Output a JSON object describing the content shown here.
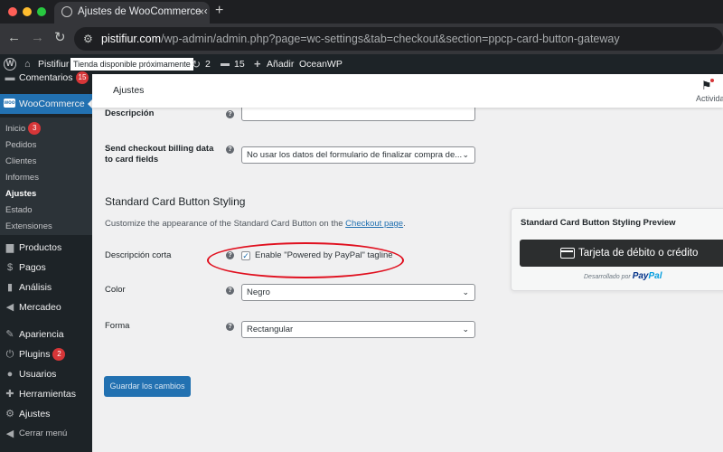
{
  "browser": {
    "tab_title": "Ajustes de WooCommerce ‹",
    "tab_close": "×",
    "new_tab": "+",
    "url_host": "pistifiur.com",
    "url_path": "/wp-admin/admin.php?page=wc-settings&tab=checkout&section=ppcp-card-button-gateway"
  },
  "adminbar": {
    "site_name": "Pistifiur",
    "site_badge": "Tienda disponible próximamente",
    "updates_count": "2",
    "comments_count": "15",
    "new_label": "Añadir",
    "theme_label": "OceanWP"
  },
  "sidebar": {
    "comments": {
      "label": "Comentarios",
      "count": "15"
    },
    "woocommerce": "WooCommerce",
    "submenu": [
      {
        "label": "Inicio",
        "count": "3"
      },
      {
        "label": "Pedidos"
      },
      {
        "label": "Clientes"
      },
      {
        "label": "Informes"
      },
      {
        "label": "Ajustes"
      },
      {
        "label": "Estado"
      },
      {
        "label": "Extensiones"
      }
    ],
    "items": [
      {
        "label": "Productos",
        "icon": "archive-icon"
      },
      {
        "label": "Pagos",
        "icon": "dollar-icon"
      },
      {
        "label": "Análisis",
        "icon": "bar-chart-icon"
      },
      {
        "label": "Mercadeo",
        "icon": "megaphone-icon"
      },
      {
        "label": "Apariencia",
        "icon": "paintbrush-icon"
      },
      {
        "label": "Plugins",
        "icon": "plug-icon",
        "count": "2"
      },
      {
        "label": "Usuarios",
        "icon": "user-icon"
      },
      {
        "label": "Herramientas",
        "icon": "wrench-icon"
      },
      {
        "label": "Ajustes",
        "icon": "settings-icon"
      },
      {
        "label": "Cerrar menú",
        "icon": "collapse-icon"
      }
    ]
  },
  "header": {
    "title": "Ajustes",
    "activity_label": "Actividad"
  },
  "form": {
    "description_label": "Descripción",
    "billing_label": "Send checkout billing data to card fields",
    "billing_value": "No usar los datos del formulario de finalizar compra de...",
    "section_title": "Standard Card Button Styling",
    "section_desc_prefix": "Customize the appearance of the Standard Card Button on the ",
    "section_desc_link": "Checkout page",
    "section_desc_suffix": ".",
    "short_desc_label": "Descripción corta",
    "tagline_checkbox_label": "Enable \"Powered by PayPal\" tagline",
    "tagline_checked": true,
    "color_label": "Color",
    "color_value": "Negro",
    "shape_label": "Forma",
    "shape_value": "Rectangular",
    "save_label": "Guardar los cambios"
  },
  "preview": {
    "title": "Standard Card Button Styling Preview",
    "button_label": "Tarjeta de débito o crédito",
    "powered_prefix": "Desarrollado por",
    "brand_pay": "Pay",
    "brand_pal": "Pal"
  },
  "colors": {
    "wp_blue": "#2271b1",
    "admin_dark": "#1d2327",
    "highlight_red": "#e0101f",
    "card_button": "#2c2e2f"
  }
}
